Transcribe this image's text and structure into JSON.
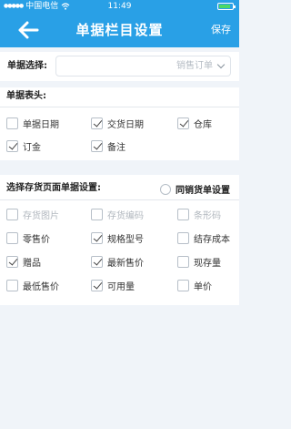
{
  "status_bar": {
    "carrier": "中国电信",
    "time": "11:49"
  },
  "nav": {
    "title": "单据栏目设置",
    "save_label": "保存"
  },
  "doc_select": {
    "label": "单据选择:",
    "value": "销售订单"
  },
  "doc_header": {
    "title": "单据表头:",
    "items": [
      {
        "label": "单据日期",
        "checked": false
      },
      {
        "label": "交货日期",
        "checked": true
      },
      {
        "label": "仓库",
        "checked": true
      },
      {
        "label": "订金",
        "checked": true
      },
      {
        "label": "备注",
        "checked": true
      }
    ]
  },
  "stock_page": {
    "title": "选择存货页面单据设置:",
    "sync_label": "同销货单设置",
    "items": [
      {
        "label": "存货图片",
        "checked": false,
        "disabled": true
      },
      {
        "label": "存货编码",
        "checked": false,
        "disabled": true
      },
      {
        "label": "条形码",
        "checked": false,
        "disabled": true
      },
      {
        "label": "零售价",
        "checked": false,
        "disabled": false
      },
      {
        "label": "规格型号",
        "checked": true,
        "disabled": false
      },
      {
        "label": "结存成本",
        "checked": false,
        "disabled": false
      },
      {
        "label": "赠品",
        "checked": true,
        "disabled": false
      },
      {
        "label": "最新售价",
        "checked": true,
        "disabled": false
      },
      {
        "label": "现存量",
        "checked": false,
        "disabled": false
      },
      {
        "label": "最低售价",
        "checked": false,
        "disabled": false
      },
      {
        "label": "可用量",
        "checked": true,
        "disabled": false
      },
      {
        "label": "单价",
        "checked": false,
        "disabled": false
      }
    ]
  }
}
